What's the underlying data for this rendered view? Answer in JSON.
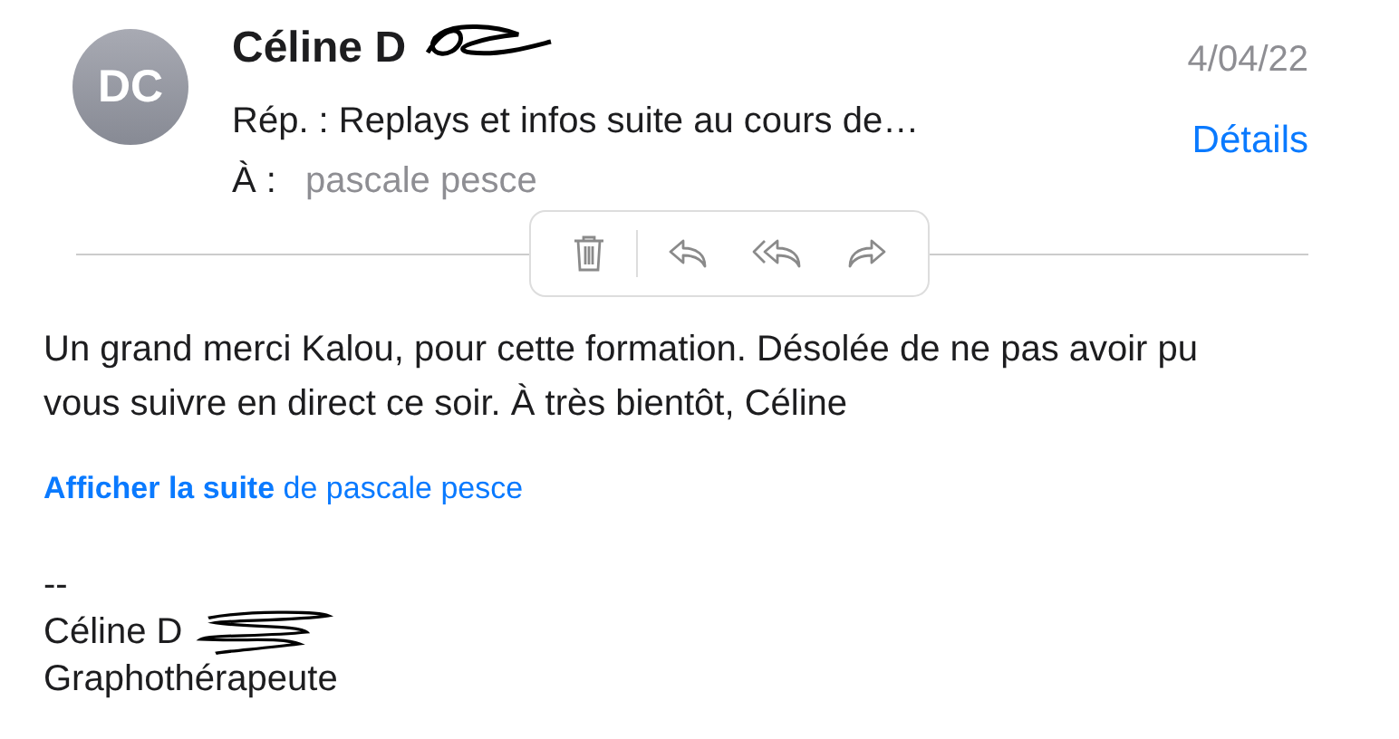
{
  "header": {
    "avatar_initials": "DC",
    "sender": "Céline D",
    "date": "4/04/22",
    "subject": "Rép. : Replays et infos suite au cours de…",
    "to_label": "À :",
    "to": "pascale pesce",
    "details": "Détails"
  },
  "toolbar": [
    {
      "kind": "trash"
    },
    {
      "kind": "reply"
    },
    {
      "kind": "reply-all"
    },
    {
      "kind": "forward"
    }
  ],
  "body": {
    "text": "Un grand merci Kalou, pour cette formation. Désolée de ne pas avoir pu vous suivre en direct ce soir. À très bientôt, Céline",
    "more_link": "Afficher la suite",
    "more_from": "de pascale pesce",
    "signature": [
      {
        "text": "--",
        "redacted": false
      },
      {
        "text": "Céline D",
        "redacted": true
      },
      {
        "text": "Graphothérapeute",
        "redacted": false
      }
    ]
  }
}
